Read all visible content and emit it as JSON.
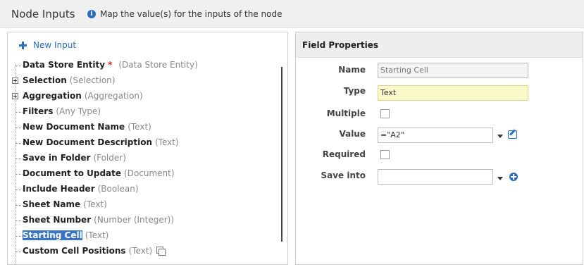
{
  "header": {
    "title": "Node Inputs",
    "info_text": "Map the value(s) for the inputs of the node"
  },
  "inputs_panel": {
    "new_input_label": "New Input",
    "items": [
      {
        "name": "Data Store Entity",
        "required_mark": "*",
        "type": "(Data Store Entity)"
      },
      {
        "name": "Selection",
        "type": "(Selection)",
        "expandable": true
      },
      {
        "name": "Aggregation",
        "type": "(Aggregation)",
        "expandable": true
      },
      {
        "name": "Filters",
        "type": "(Any Type)"
      },
      {
        "name": "New Document Name",
        "type": "(Text)"
      },
      {
        "name": "New Document Description",
        "type": "(Text)"
      },
      {
        "name": "Save in Folder",
        "type": "(Folder)"
      },
      {
        "name": "Document to Update",
        "type": "(Document)"
      },
      {
        "name": "Include Header",
        "type": "(Boolean)"
      },
      {
        "name": "Sheet Name",
        "type": "(Text)"
      },
      {
        "name": "Sheet Number",
        "type": "(Number (Integer))"
      },
      {
        "name": "Starting Cell",
        "type": "(Text)",
        "selected": true
      },
      {
        "name": "Custom Cell Positions",
        "type": "(Text)",
        "copy_icon": "copy-icon"
      }
    ]
  },
  "field_properties": {
    "title": "Field Properties",
    "name_label": "Name",
    "name_value": "Starting Cell",
    "type_label": "Type",
    "type_value": "Text",
    "multiple_label": "Multiple",
    "multiple_checked": false,
    "value_label": "Value",
    "value_value": "=\"A2\"",
    "required_label": "Required",
    "required_checked": false,
    "save_into_label": "Save into",
    "save_into_value": ""
  },
  "colors": {
    "accent": "#2a6ebb",
    "selection": "#3a75c4",
    "required": "#d9262b",
    "type_field_bg": "#fcf9c9"
  },
  "icons": {
    "info": "info-icon",
    "new_input": "plus-icon",
    "value_edit": "edit-icon",
    "save_into_add": "add-circle-icon",
    "dropdown": "chevron-down-icon"
  }
}
